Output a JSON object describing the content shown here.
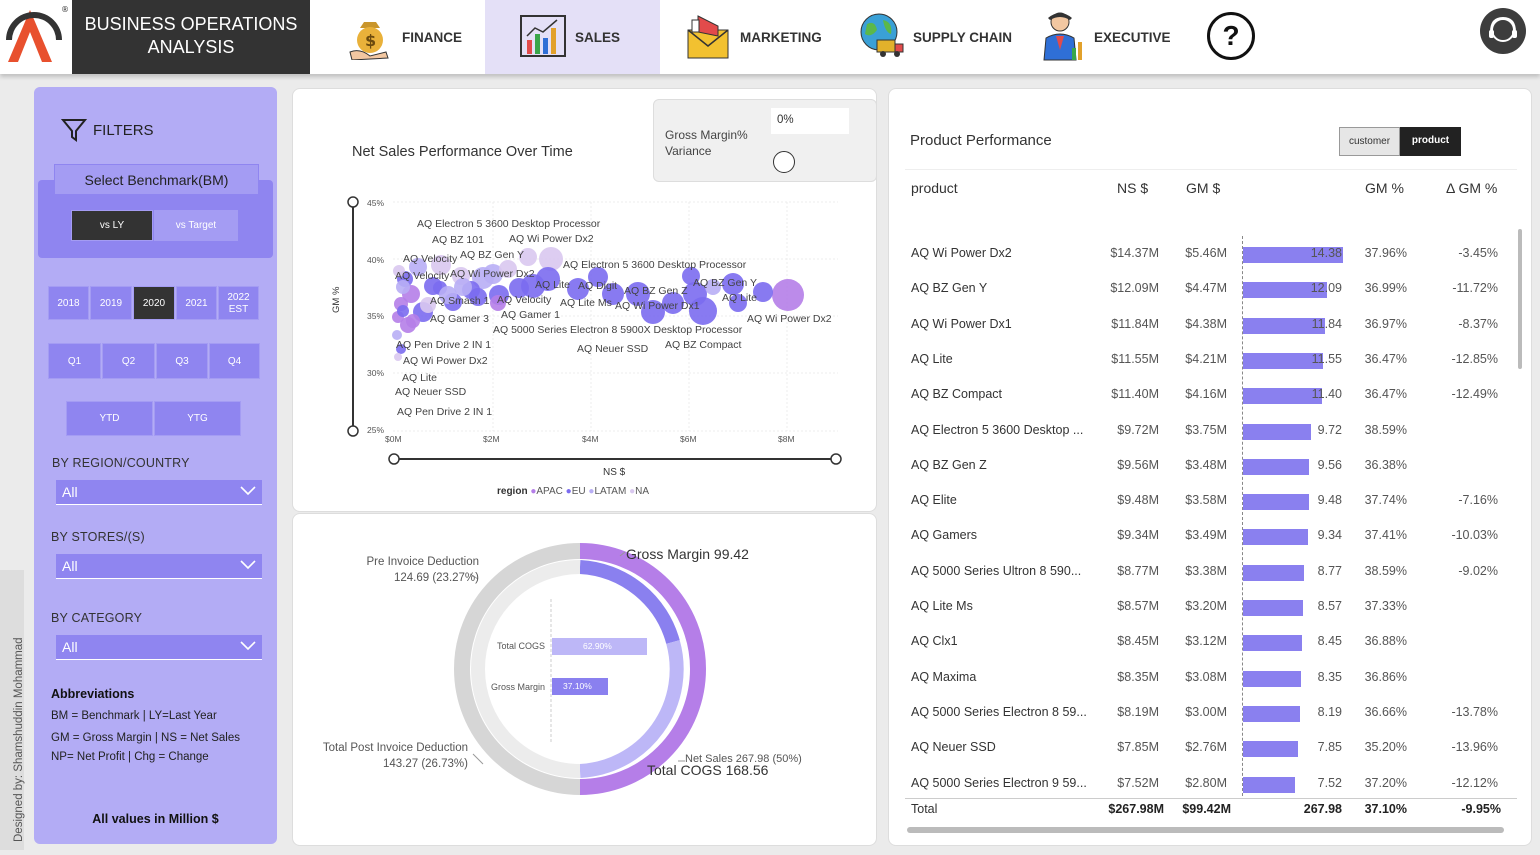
{
  "header": {
    "title_line1": "BUSINESS OPERATIONS",
    "title_line2": "ANALYSIS",
    "nav": [
      {
        "label": "FINANCE",
        "icon": "money-bag-icon"
      },
      {
        "label": "SALES",
        "icon": "bar-chart-icon",
        "active": true
      },
      {
        "label": "MARKETING",
        "icon": "megaphone-icon"
      },
      {
        "label": "SUPPLY CHAIN",
        "icon": "globe-truck-icon"
      },
      {
        "label": "EXECUTIVE",
        "icon": "executive-icon"
      }
    ],
    "help": "?",
    "accent": "#e4e0f7"
  },
  "sidebar": {
    "filters_label": "FILTERS",
    "benchmark_label": "Select Benchmark(BM)",
    "benchmarks": [
      "vs LY",
      "vs Target"
    ],
    "selected_benchmark": "vs LY",
    "years": [
      "2018",
      "2019",
      "2020",
      "2021",
      "2022 EST"
    ],
    "selected_year": "2020",
    "quarters": [
      "Q1",
      "Q2",
      "Q3",
      "Q4"
    ],
    "ytd": [
      "YTD",
      "YTG"
    ],
    "region_label": "BY REGION/COUNTRY",
    "region_value": "All",
    "stores_label": "BY STORES/(S)",
    "stores_value": "All",
    "category_label": "BY CATEGORY",
    "category_value": "All",
    "abbr_title": "Abbreviations",
    "abbr": [
      "BM = Benchmark | LY=Last Year",
      "GM = Gross Margin | NS = Net Sales",
      "NP= Net Profit | Chg = Change"
    ],
    "footer": "All values in Million $",
    "designer": "Designed by: Shamshuddin Mohammad",
    "color": "#b3acf5"
  },
  "scatter": {
    "title": "Net Sales Performance Over Time",
    "gm_variance_label_1": "Gross Margin%",
    "gm_variance_label_2": "Variance",
    "gm_variance_value": "0%",
    "xlabel": "NS $",
    "ylabel": "GM %",
    "yticks": [
      "45%",
      "40%",
      "35%",
      "30%",
      "25%"
    ],
    "xticks": [
      "$0M",
      "$2M",
      "$4M",
      "$6M",
      "$8M"
    ],
    "legend_title": "region",
    "legend": [
      {
        "name": "APAC",
        "color": "#b57ee8"
      },
      {
        "name": "EU",
        "color": "#7b6cf0"
      },
      {
        "name": "LATAM",
        "color": "#b8aef5"
      },
      {
        "name": "NA",
        "color": "#d9c8ef"
      }
    ],
    "labels": [
      "AQ Electron 5 3600 Desktop Processor",
      "AQ BZ 101",
      "AQ Wi Power Dx2",
      "AQ Velocity",
      "AQ BZ Gen Y",
      "AQ Velocity",
      "AQ Wi Power Dx2",
      "AQ Electron 5 3600 Desktop Processor",
      "AQ Lite",
      "AQ Digit",
      "AQ BZ Gen Z",
      "AQ BZ Gen Y",
      "AQ Smash 1",
      "AQ Velocity",
      "AQ Lite Ms",
      "AQ Wi Power Dx1",
      "AQ Lite",
      "AQ Gamer 3",
      "AQ Gamer 1",
      "AQ Wi Power Dx2",
      "AQ 5000 Series Electron 8 5900X Desktop Processor",
      "AQ Neuer SSD",
      "AQ BZ Compact",
      "AQ Pen Drive 2 IN 1",
      "AQ Wi Power Dx2",
      "AQ Lite",
      "AQ Neuer SSD",
      "AQ Pen Drive 2 IN 1"
    ]
  },
  "chart_data": {
    "type": "donut",
    "slices": [
      {
        "name": "Gross Margin",
        "value": 99.42
      },
      {
        "name": "Total COGS",
        "value": 168.56
      },
      {
        "name": "Net Sales",
        "value": 267.98,
        "pct": "50%"
      },
      {
        "name": "Total Post Invoice Deduction",
        "value": 143.27,
        "pct": "26.73%"
      },
      {
        "name": "Pre Invoice Deduction",
        "value": 124.69,
        "pct": "23.27%"
      }
    ],
    "inner_bars": [
      {
        "name": "Total COGS",
        "value": 62.9,
        "label": "62.90%"
      },
      {
        "name": "Gross Margin",
        "value": 37.1,
        "label": "37.10%"
      }
    ]
  },
  "donut_text": {
    "gm": "Gross Margin 99.42",
    "cogs": "Total COGS 168.56",
    "ns": "Net Sales 267.98 (50%)",
    "pre_name": "Pre Invoice Deduction",
    "pre_val": "124.69 (23.27%)",
    "post_name": "Total Post Invoice Deduction",
    "post_val": "143.27 (26.73%)",
    "inner_cogs_label": "Total COGS",
    "inner_cogs_val": "62.90%",
    "inner_gm_label": "Gross Margin",
    "inner_gm_val": "37.10%"
  },
  "product_table": {
    "title": "Product Performance",
    "toggle": [
      "customer",
      "product"
    ],
    "selected_toggle": "product",
    "columns": [
      "product",
      "NS $",
      "GM $",
      "GM %",
      "Δ GM %"
    ],
    "rows": [
      {
        "product": "AQ Wi Power Dx2",
        "ns": "$14.37M",
        "gm": "$5.46M",
        "bar": 14.38,
        "barlabel": "14.38",
        "gmp": "37.96%",
        "dgm": "-3.45%"
      },
      {
        "product": "AQ BZ Gen Y",
        "ns": "$12.09M",
        "gm": "$4.47M",
        "bar": 12.09,
        "barlabel": "12.09",
        "gmp": "36.99%",
        "dgm": "-11.72%"
      },
      {
        "product": "AQ Wi Power Dx1",
        "ns": "$11.84M",
        "gm": "$4.38M",
        "bar": 11.84,
        "barlabel": "11.84",
        "gmp": "36.97%",
        "dgm": "-8.37%"
      },
      {
        "product": "AQ Lite",
        "ns": "$11.55M",
        "gm": "$4.21M",
        "bar": 11.55,
        "barlabel": "11.55",
        "gmp": "36.47%",
        "dgm": "-12.85%"
      },
      {
        "product": "AQ BZ Compact",
        "ns": "$11.40M",
        "gm": "$4.16M",
        "bar": 11.4,
        "barlabel": "11.40",
        "gmp": "36.47%",
        "dgm": "-12.49%"
      },
      {
        "product": "AQ Electron 5 3600 Desktop ...",
        "ns": "$9.72M",
        "gm": "$3.75M",
        "bar": 9.72,
        "barlabel": "9.72",
        "gmp": "38.59%",
        "dgm": ""
      },
      {
        "product": "AQ BZ Gen Z",
        "ns": "$9.56M",
        "gm": "$3.48M",
        "bar": 9.56,
        "barlabel": "9.56",
        "gmp": "36.38%",
        "dgm": ""
      },
      {
        "product": "AQ Elite",
        "ns": "$9.48M",
        "gm": "$3.58M",
        "bar": 9.48,
        "barlabel": "9.48",
        "gmp": "37.74%",
        "dgm": "-7.16%"
      },
      {
        "product": "AQ Gamers",
        "ns": "$9.34M",
        "gm": "$3.49M",
        "bar": 9.34,
        "barlabel": "9.34",
        "gmp": "37.41%",
        "dgm": "-10.03%"
      },
      {
        "product": "AQ 5000 Series Ultron 8 590...",
        "ns": "$8.77M",
        "gm": "$3.38M",
        "bar": 8.77,
        "barlabel": "8.77",
        "gmp": "38.59%",
        "dgm": "-9.02%"
      },
      {
        "product": "AQ Lite Ms",
        "ns": "$8.57M",
        "gm": "$3.20M",
        "bar": 8.57,
        "barlabel": "8.57",
        "gmp": "37.33%",
        "dgm": ""
      },
      {
        "product": "AQ Clx1",
        "ns": "$8.45M",
        "gm": "$3.12M",
        "bar": 8.45,
        "barlabel": "8.45",
        "gmp": "36.88%",
        "dgm": ""
      },
      {
        "product": "AQ Maxima",
        "ns": "$8.35M",
        "gm": "$3.08M",
        "bar": 8.35,
        "barlabel": "8.35",
        "gmp": "36.86%",
        "dgm": ""
      },
      {
        "product": "AQ 5000 Series Electron 8 59...",
        "ns": "$8.19M",
        "gm": "$3.00M",
        "bar": 8.19,
        "barlabel": "8.19",
        "gmp": "36.66%",
        "dgm": "-13.78%"
      },
      {
        "product": "AQ Neuer SSD",
        "ns": "$7.85M",
        "gm": "$2.76M",
        "bar": 7.85,
        "barlabel": "7.85",
        "gmp": "35.20%",
        "dgm": "-13.96%"
      },
      {
        "product": "AQ 5000 Series Electron 9 59...",
        "ns": "$7.52M",
        "gm": "$2.80M",
        "bar": 7.52,
        "barlabel": "7.52",
        "gmp": "37.20%",
        "dgm": "-12.12%"
      }
    ],
    "total": {
      "product": "Total",
      "ns": "$267.98M",
      "gm": "$99.42M",
      "bar": "267.98",
      "gmp": "37.10%",
      "dgm": "-9.95%"
    }
  }
}
